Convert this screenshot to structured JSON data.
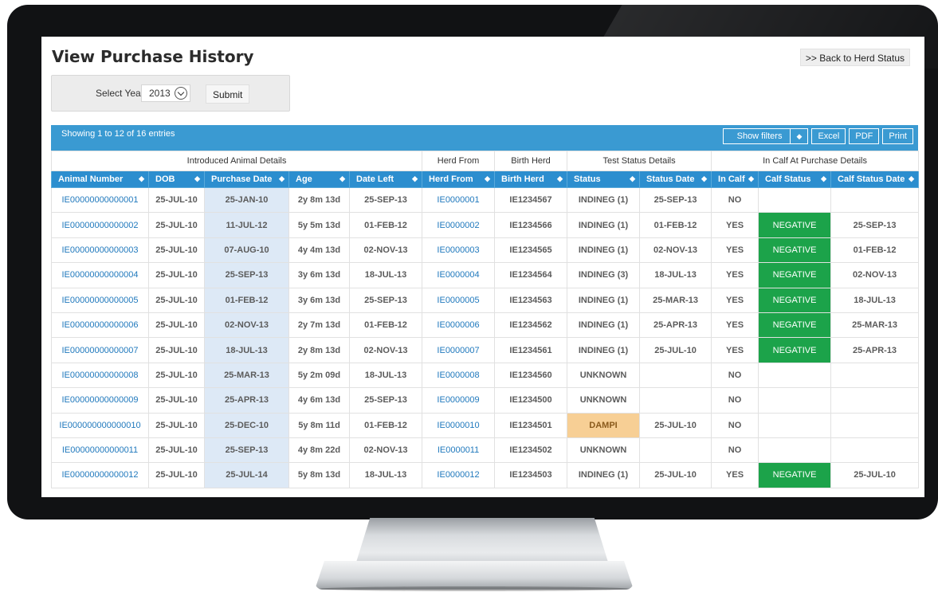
{
  "page": {
    "title": "View Purchase History",
    "back_link": ">> Back to Herd Status"
  },
  "year_filter": {
    "label": "Select Year",
    "value": "2013",
    "submit_label": "Submit"
  },
  "info": {
    "showing": "Showing 1 to 12 of 16 entries"
  },
  "tools": {
    "show_filters": "Show filters",
    "excel": "Excel",
    "pdf": "PDF",
    "print": "Print"
  },
  "groups": [
    "Introduced Animal Details",
    "Herd From",
    "Birth Herd",
    "Test Status Details",
    "In Calf At Purchase Details"
  ],
  "columns": [
    "Animal Number",
    "DOB",
    "Purchase Date",
    "Age",
    "Date  Left",
    "Herd From",
    "Birth Herd",
    "Status",
    "Status Date",
    "In Calf",
    "Calf Status",
    "Calf Status Date"
  ],
  "rows": [
    {
      "animal": "IE00000000000001",
      "dob": "25-JUL-10",
      "purchase": "25-JAN-10",
      "age": "2y 8m 13d",
      "left": "25-SEP-13",
      "herd_from": "IE0000001",
      "birth_herd": "IE1234567",
      "status": "INDINEG (1)",
      "status_date": "25-SEP-13",
      "in_calf": "NO",
      "calf_status": "",
      "calf_status_date": ""
    },
    {
      "animal": "IE00000000000002",
      "dob": "25-JUL-10",
      "purchase": "11-JUL-12",
      "age": "5y 5m 13d",
      "left": "01-FEB-12",
      "herd_from": "IE0000002",
      "birth_herd": "IE1234566",
      "status": "INDINEG (1)",
      "status_date": "01-FEB-12",
      "in_calf": "YES",
      "calf_status": "NEGATIVE",
      "calf_status_date": "25-SEP-13"
    },
    {
      "animal": "IE00000000000003",
      "dob": "25-JUL-10",
      "purchase": "07-AUG-10",
      "age": "4y 4m 13d",
      "left": "02-NOV-13",
      "herd_from": "IE0000003",
      "birth_herd": "IE1234565",
      "status": "INDINEG (1)",
      "status_date": "02-NOV-13",
      "in_calf": "YES",
      "calf_status": "NEGATIVE",
      "calf_status_date": "01-FEB-12"
    },
    {
      "animal": "IE00000000000004",
      "dob": "25-JUL-10",
      "purchase": "25-SEP-13",
      "age": "3y 6m 13d",
      "left": "18-JUL-13",
      "herd_from": "IE0000004",
      "birth_herd": "IE1234564",
      "status": "INDINEG (3)",
      "status_date": "18-JUL-13",
      "in_calf": "YES",
      "calf_status": "NEGATIVE",
      "calf_status_date": "02-NOV-13"
    },
    {
      "animal": "IE00000000000005",
      "dob": "25-JUL-10",
      "purchase": "01-FEB-12",
      "age": "3y 6m 13d",
      "left": "25-SEP-13",
      "herd_from": "IE0000005",
      "birth_herd": "IE1234563",
      "status": "INDINEG (1)",
      "status_date": "25-MAR-13",
      "in_calf": "YES",
      "calf_status": "NEGATIVE",
      "calf_status_date": "18-JUL-13"
    },
    {
      "animal": "IE00000000000006",
      "dob": "25-JUL-10",
      "purchase": "02-NOV-13",
      "age": "2y 7m 13d",
      "left": "01-FEB-12",
      "herd_from": "IE0000006",
      "birth_herd": "IE1234562",
      "status": "INDINEG (1)",
      "status_date": "25-APR-13",
      "in_calf": "YES",
      "calf_status": "NEGATIVE",
      "calf_status_date": "25-MAR-13"
    },
    {
      "animal": "IE00000000000007",
      "dob": "25-JUL-10",
      "purchase": "18-JUL-13",
      "age": "2y 8m 13d",
      "left": "02-NOV-13",
      "herd_from": "IE0000007",
      "birth_herd": "IE1234561",
      "status": "INDINEG (1)",
      "status_date": "25-JUL-10",
      "in_calf": "YES",
      "calf_status": "NEGATIVE",
      "calf_status_date": "25-APR-13"
    },
    {
      "animal": "IE00000000000008",
      "dob": "25-JUL-10",
      "purchase": "25-MAR-13",
      "age": "5y 2m 09d",
      "left": "18-JUL-13",
      "herd_from": "IE0000008",
      "birth_herd": "IE1234560",
      "status": "UNKNOWN",
      "status_date": "",
      "in_calf": "NO",
      "calf_status": "",
      "calf_status_date": ""
    },
    {
      "animal": "IE00000000000009",
      "dob": "25-JUL-10",
      "purchase": "25-APR-13",
      "age": "4y 6m 13d",
      "left": "25-SEP-13",
      "herd_from": "IE0000009",
      "birth_herd": "IE1234500",
      "status": "UNKNOWN",
      "status_date": "",
      "in_calf": "NO",
      "calf_status": "",
      "calf_status_date": ""
    },
    {
      "animal": "IE000000000000010",
      "dob": "25-JUL-10",
      "purchase": "25-DEC-10",
      "age": "5y 8m 11d",
      "left": "01-FEB-12",
      "herd_from": "IE0000010",
      "birth_herd": "IE1234501",
      "status": "DAMPI",
      "status_date": "25-JUL-10",
      "in_calf": "NO",
      "calf_status": "",
      "calf_status_date": ""
    },
    {
      "animal": "IE00000000000011",
      "dob": "25-JUL-10",
      "purchase": "25-SEP-13",
      "age": "4y 8m 22d",
      "left": "02-NOV-13",
      "herd_from": "IE0000011",
      "birth_herd": "IE1234502",
      "status": "UNKNOWN",
      "status_date": "",
      "in_calf": "NO",
      "calf_status": "",
      "calf_status_date": ""
    },
    {
      "animal": "IE00000000000012",
      "dob": "25-JUL-10",
      "purchase": "25-JUL-14",
      "age": "5y 8m 13d",
      "left": "18-JUL-13",
      "herd_from": "IE0000012",
      "birth_herd": "IE1234503",
      "status": "INDINEG (1)",
      "status_date": "25-JUL-10",
      "in_calf": "YES",
      "calf_status": "NEGATIVE",
      "calf_status_date": "25-JUL-10"
    }
  ],
  "colors": {
    "header_blue": "#2c8ecf",
    "info_bar_blue": "#3a9ad2",
    "link_blue": "#2079bd",
    "negative_green": "#1ca34a",
    "dampi_orange": "#f7cf95",
    "purchase_col_bg": "#dde9f6"
  },
  "icons": {
    "year_dropdown": "chevron-down-icon",
    "sort": "sort-arrows-icon"
  }
}
